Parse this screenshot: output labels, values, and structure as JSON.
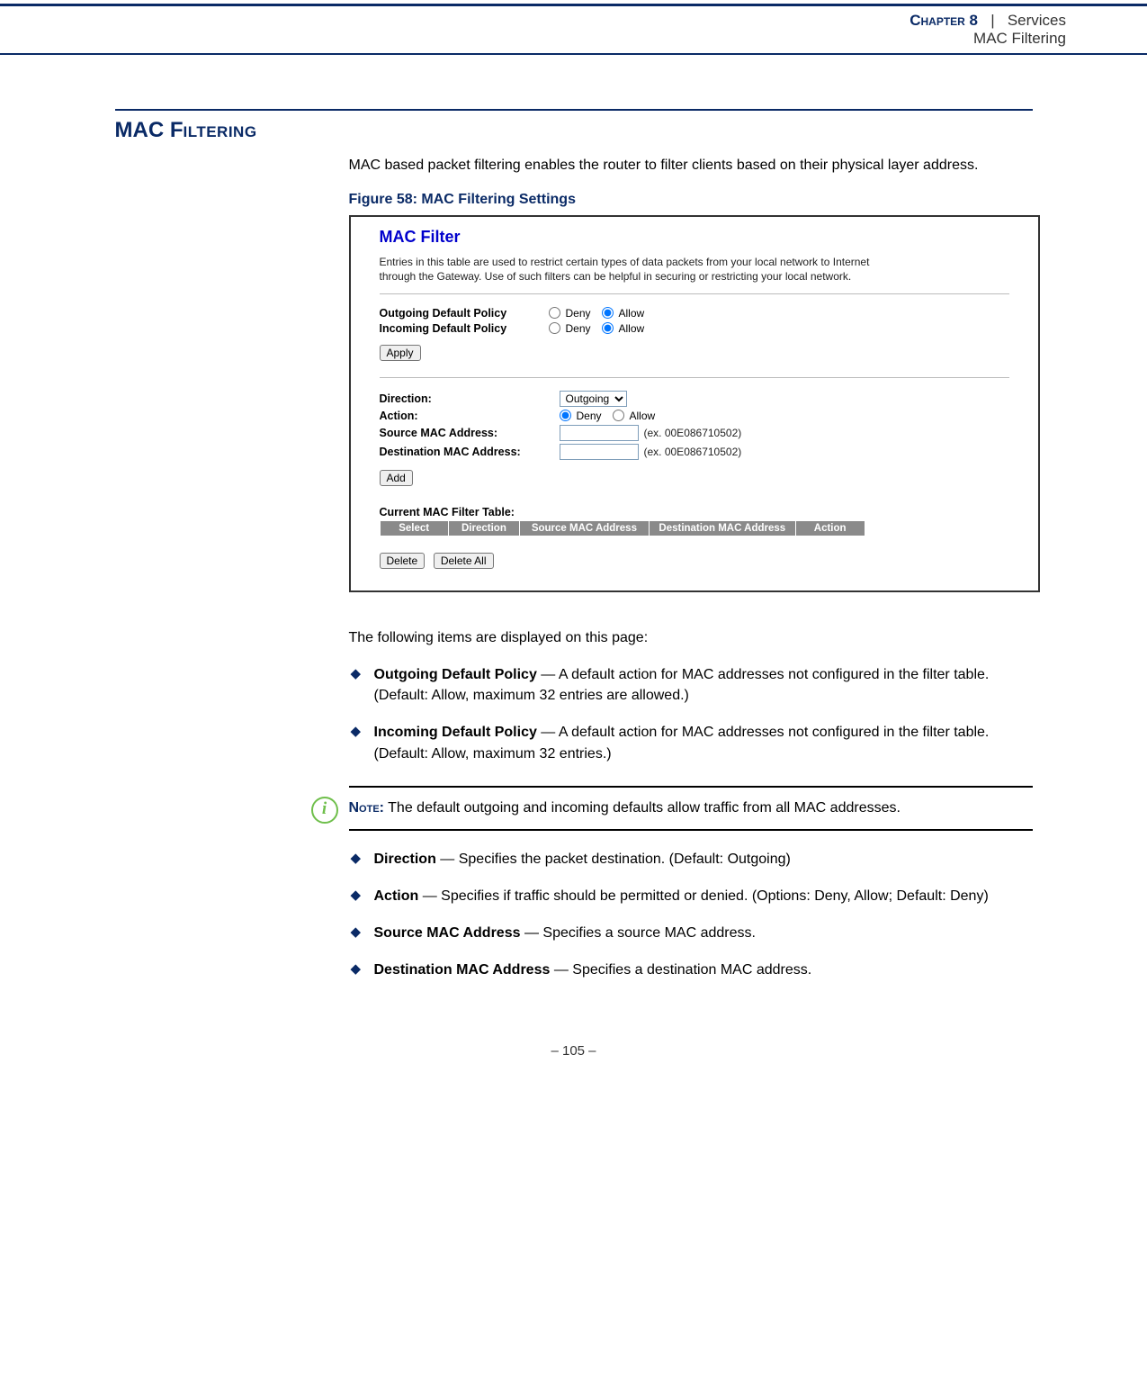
{
  "header": {
    "chapter": "Chapter 8",
    "separator": "|",
    "services": "Services",
    "subtitle": "MAC Filtering"
  },
  "section": {
    "title_prefix": "MAC F",
    "title_rest": "iltering"
  },
  "intro": "MAC based packet filtering enables the router to filter clients based on their physical layer address.",
  "figure_caption": "Figure 58:  MAC Filtering Settings",
  "screenshot": {
    "heading": "MAC Filter",
    "description": "Entries in this table are used to restrict certain types of data packets from your local network to Internet through the Gateway. Use of such filters can be helpful in securing or restricting your local network.",
    "policy": {
      "outgoing_label": "Outgoing Default Policy",
      "incoming_label": "Incoming Default Policy",
      "deny": "Deny",
      "allow": "Allow"
    },
    "apply_btn": "Apply",
    "form": {
      "direction_label": "Direction:",
      "direction_value": "Outgoing",
      "action_label": "Action:",
      "deny": "Deny",
      "allow": "Allow",
      "src_label": "Source MAC Address:",
      "dst_label": "Destination MAC Address:",
      "hint": "(ex. 00E086710502)"
    },
    "add_btn": "Add",
    "table_title": "Current MAC Filter Table:",
    "cols": {
      "select": "Select",
      "direction": "Direction",
      "src": "Source MAC Address",
      "dst": "Destination MAC Address",
      "action": "Action"
    },
    "delete_btn": "Delete",
    "delete_all_btn": "Delete All"
  },
  "items_intro": "The following items are displayed on this page:",
  "items": [
    {
      "term": "Outgoing Default Policy",
      "desc": " — A default action for MAC addresses not configured in the filter table. (Default: Allow, maximum 32 entries are allowed.)"
    },
    {
      "term": "Incoming Default Policy",
      "desc": " — A default action for MAC addresses not configured in the filter table. (Default: Allow, maximum 32 entries.)"
    }
  ],
  "note": {
    "label": "Note:",
    "text": " The default outgoing and incoming defaults allow traffic from all MAC addresses."
  },
  "items2": [
    {
      "term": "Direction",
      "desc": " — Specifies the packet destination. (Default: Outgoing)"
    },
    {
      "term": "Action",
      "desc": " — Specifies if traffic should be permitted or denied. (Options: Deny, Allow; Default: Deny)"
    },
    {
      "term": "Source MAC Address",
      "desc": " — Specifies a source MAC address."
    },
    {
      "term": "Destination MAC Address",
      "desc": " — Specifies a destination MAC address."
    }
  ],
  "page_number": "–  105  –"
}
